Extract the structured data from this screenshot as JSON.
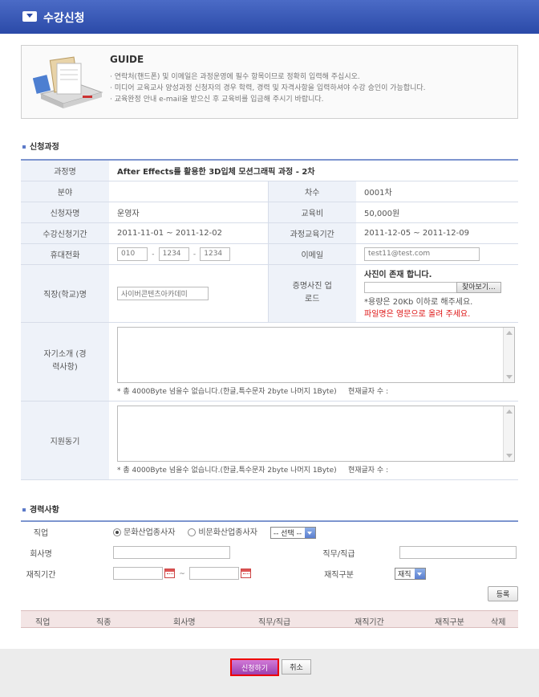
{
  "window": {
    "title": "수강신청"
  },
  "guide": {
    "title": "GUIDE",
    "items": [
      "· 연락처(핸드폰) 및 이메일은 과정운영에 필수 항목이므로 정확히 입력해 주십시오.",
      "· 미디어 교육교사 양성과정 신청자의 경우 학력, 경력 및 자격사항을 입력하셔야 수강 승인이 가능합니다.",
      "· 교육완정 안내 e-mail을 받으신 후 교육비를 입금해 주시기 바랍니다."
    ]
  },
  "section1": {
    "title": "신청과정"
  },
  "form": {
    "course_label": "과정명",
    "course_value": "After Effects를 활용한 3D입체 모션그래픽 과정 - 2차",
    "field_label": "분야",
    "field_value": "",
    "round_label": "차수",
    "round_value": "0001차",
    "applicant_label": "신청자명",
    "applicant_value": "운영자",
    "fee_label": "교육비",
    "fee_value": "50,000원",
    "apply_period_label": "수강신청기간",
    "apply_period_value": "2011-11-01 ~ 2011-12-02",
    "edu_period_label": "과정교육기간",
    "edu_period_value": "2011-12-05 ~ 2011-12-09",
    "phone_label": "휴대전화",
    "phone1": "010",
    "phone2": "1234",
    "phone3": "1234",
    "phone_sep": "-",
    "email_label": "이메일",
    "email_value": "test11@test.com",
    "company_label": "직장(학교)명",
    "company_value": "사이버콘텐츠아카데미",
    "photo_label": "증명사진 업로드",
    "photo_exists": "사진이 존재 합니다.",
    "browse_label": "찾아보기...",
    "photo_note1": "*용량은 20Kb 이하로 해주세요.",
    "photo_note2": "파일명은 영문으로 올려 주세요.",
    "intro_label": "자기소개 (경력사항)",
    "intro_hint": "* 총 4000Byte 넘을수 없습니다.(한글,특수문자 2byte 나머지 1Byte)",
    "char_count_label": "현재글자 수 :",
    "motive_label": "지원동기",
    "motive_hint": "* 총 4000Byte 넘을수 없습니다.(한글,특수문자 2byte 나머지 1Byte)"
  },
  "section2": {
    "title": "경력사항"
  },
  "career": {
    "job_label": "직업",
    "radio1": "문화산업종사자",
    "radio2": "비문화산업종사자",
    "select_job": "-- 선택 --",
    "company_label": "회사명",
    "position_label": "직무/직급",
    "period_label": "재직기간",
    "period_sep": "~",
    "status_label": "재직구분",
    "status_value": "재직",
    "register_label": "등록"
  },
  "list": {
    "headers": [
      "직업",
      "직종",
      "회사명",
      "직무/직급",
      "재직기간",
      "재직구분",
      "삭제"
    ]
  },
  "footer": {
    "apply_label": "신청하기",
    "cancel_label": "취소"
  }
}
